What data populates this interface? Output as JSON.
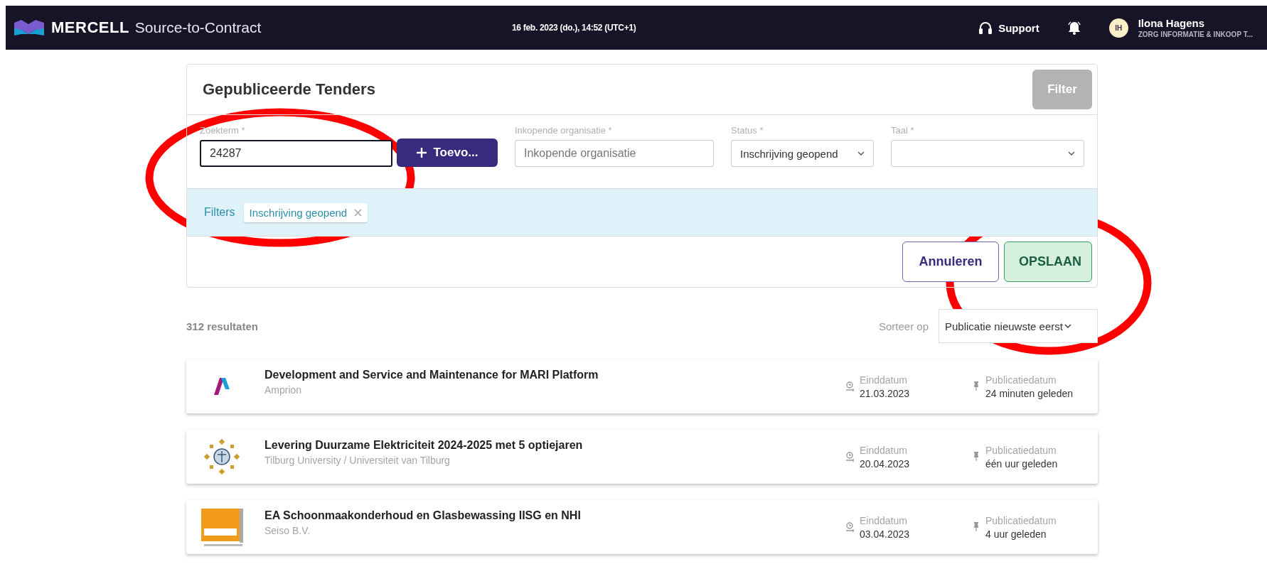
{
  "header": {
    "brand": "MERCELL",
    "product": "Source-to-Contract",
    "datetime": "16 feb. 2023 (do.), 14:52 (UTC+1)",
    "support": "Support",
    "user": {
      "initials": "IH",
      "name": "Ilona Hagens",
      "organisation": "ZORG INFORMATIE & INKOOP T..."
    }
  },
  "search_panel": {
    "title": "Gepubliceerde Tenders",
    "filter_button": {
      "label": "Filter",
      "disabled": true
    },
    "fields": [
      {
        "kind": "text",
        "label": "Zoekterm *",
        "value": "24287",
        "focused": true
      },
      {
        "kind": "button",
        "label": "Toevo..."
      },
      {
        "kind": "text",
        "label": "Inkopende organisatie *",
        "placeholder": "Inkopende organisatie",
        "focused": false
      },
      {
        "kind": "select",
        "label": "Status *",
        "value": "Inschrijving geopend"
      },
      {
        "kind": "select",
        "label": "Taal *"
      }
    ],
    "filters_label": "Filters",
    "filter_chips": [
      {
        "label": "Inschrijving geopend"
      }
    ],
    "buttons": [
      {
        "kind": "secondary",
        "label": "Annuleren"
      },
      {
        "kind": "primary",
        "label": "OPSLAAN"
      }
    ]
  },
  "results": {
    "count": "312 resultaten",
    "sort_label": "Sorteer op",
    "sort_value": "Publicatie nieuwste eerst",
    "rows": [
      {
        "logo": {
          "kind": "amprion"
        },
        "title": "Development and Service and Maintenance for MARI Platform",
        "organisation": "Amprion",
        "end_label": "Einddatum",
        "end_date": "21.03.2023",
        "pub_label": "Publicatiedatum",
        "pub_date": "24 minuten geleden"
      },
      {
        "logo": {
          "kind": "seal"
        },
        "title": "Levering Duurzame Elektriciteit 2024-2025 met 5 optiejaren",
        "organisation": "Tilburg University / Universiteit van Tilburg",
        "end_label": "Einddatum",
        "end_date": "20.04.2023",
        "pub_label": "Publicatiedatum",
        "pub_date": "één uur geleden"
      },
      {
        "logo": {
          "kind": "seiso"
        },
        "title": "EA Schoonmaakonderhoud en Glasbewassing IISG en NHI",
        "organisation": "Seiso B.V.",
        "end_label": "Einddatum",
        "end_date": "03.04.2023",
        "pub_label": "Publicatiedatum",
        "pub_date": "4 uur geleden"
      }
    ]
  },
  "annotations": [
    {
      "kind": "ellipse"
    },
    {
      "kind": "ellipse"
    }
  ]
}
